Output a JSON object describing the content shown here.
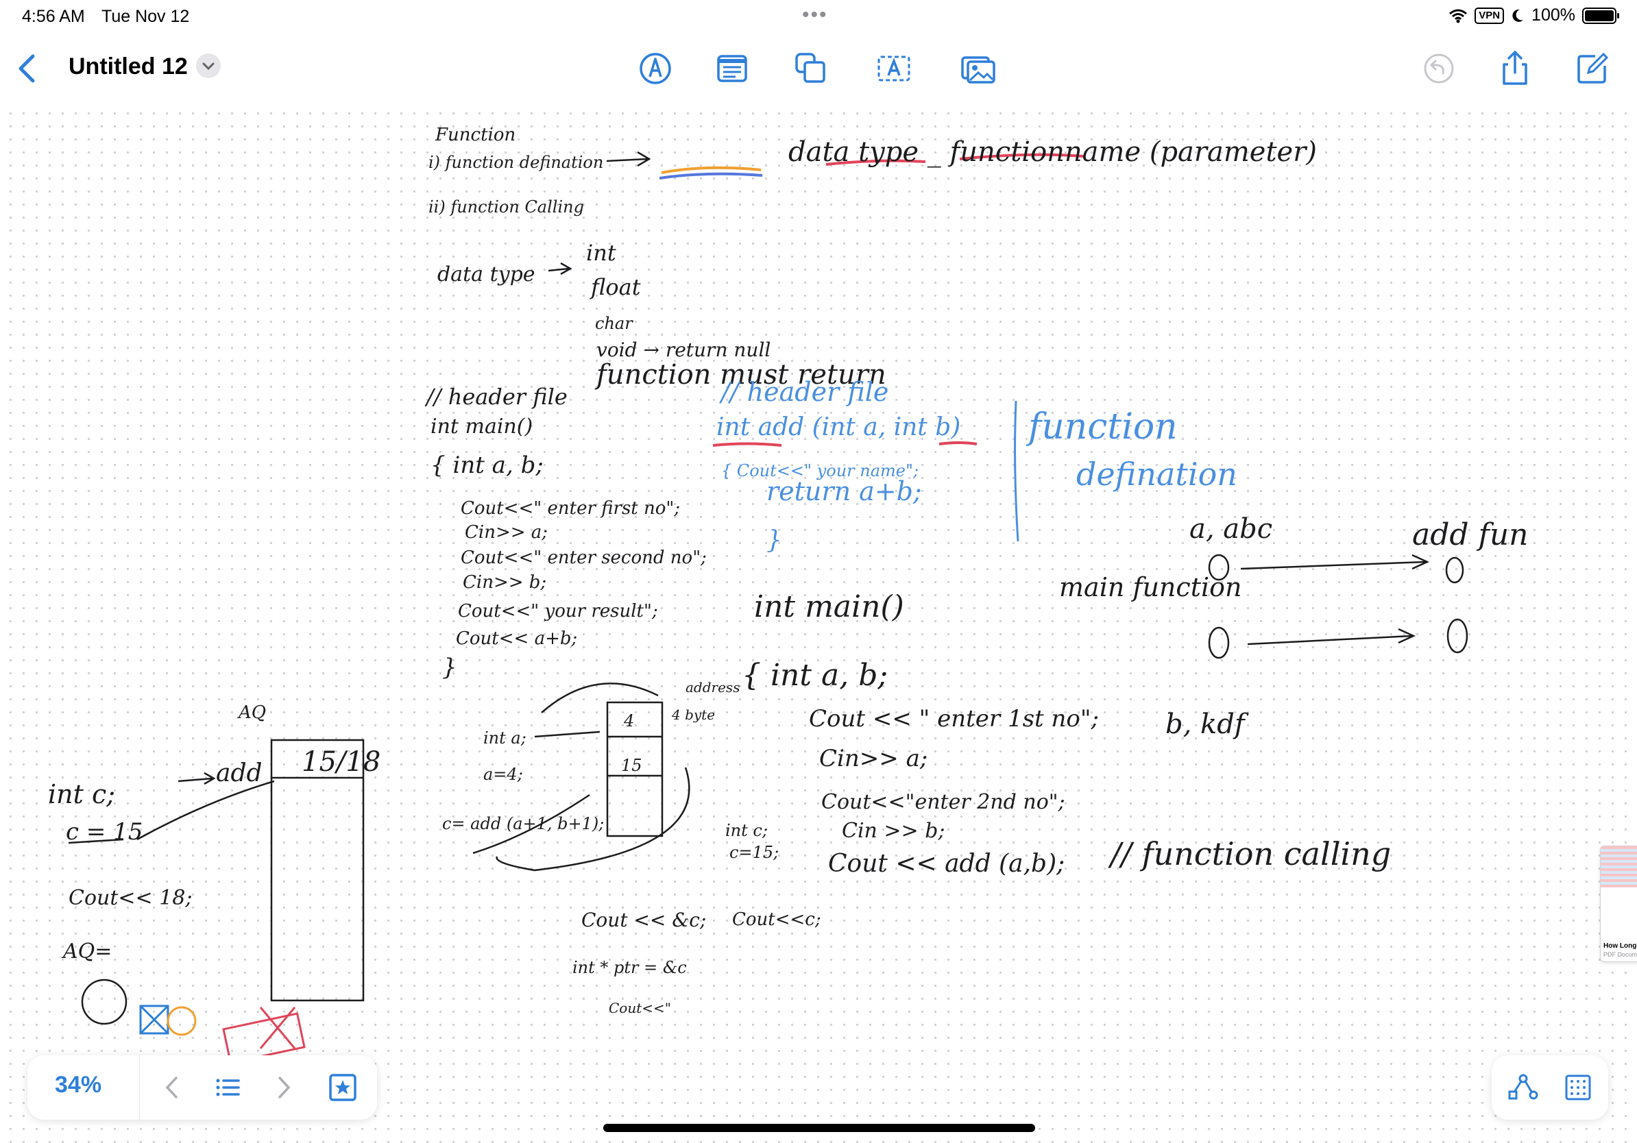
{
  "status_bar": {
    "time": "4:56 AM",
    "date": "Tue Nov 12",
    "vpn": "VPN",
    "battery": "100%"
  },
  "navbar": {
    "title": "Untitled 12",
    "tools": [
      "pen-tool-icon",
      "text-box-icon",
      "shapes-icon",
      "text-format-icon",
      "media-icon"
    ],
    "accent_color": "#2f7fd8"
  },
  "canvas": {
    "notes_black": [
      "Function",
      "i) function defination",
      "ii) function Calling",
      "data type",
      "int",
      "float",
      "char",
      "void → return null",
      "function must return",
      "// header file",
      "int main()",
      "{ int a, b;",
      "Cout<<\" enter first no\";",
      "Cin>> a;",
      "Cout<<\" enter second no\";",
      "Cin>> b;",
      "Cout<<\" your result\";",
      "Cout<< a+b;",
      "}",
      "int a;",
      "a=4;",
      "c= add (a+1, b+1);",
      "4",
      "15",
      "address",
      "4 byte",
      "int main()",
      "{ int a, b;",
      "Cout << \" enter 1st no\";",
      "Cin>> a;",
      "Cout<<\"enter 2nd no\";",
      "Cin >> b;",
      "Cout << add (a,b);",
      "// function calling",
      "int c;",
      "c=15;",
      "Cout << &c;",
      "int * ptr = &c",
      "Cout<<\"",
      "Cout<<c;",
      "main function",
      "a, abc",
      "add fun",
      "b, kdf",
      "int c;",
      "add",
      "c = 15",
      "Cout<< 18;",
      "AQ",
      "AQ=",
      "15/18",
      "data type _ functionname (parameter)"
    ],
    "notes_blue": [
      "// header file",
      "int add (int a, int b)",
      "{ Cout<<\" your name\";",
      "return a+b;",
      "}",
      "function",
      "defination"
    ]
  },
  "bottom_toolbar": {
    "zoom": "34%",
    "buttons": [
      "previous-icon",
      "list-icon",
      "next-icon",
      "star-icon"
    ]
  },
  "side_document": {
    "title": "How Long",
    "subtitle": "PDF Docum"
  }
}
